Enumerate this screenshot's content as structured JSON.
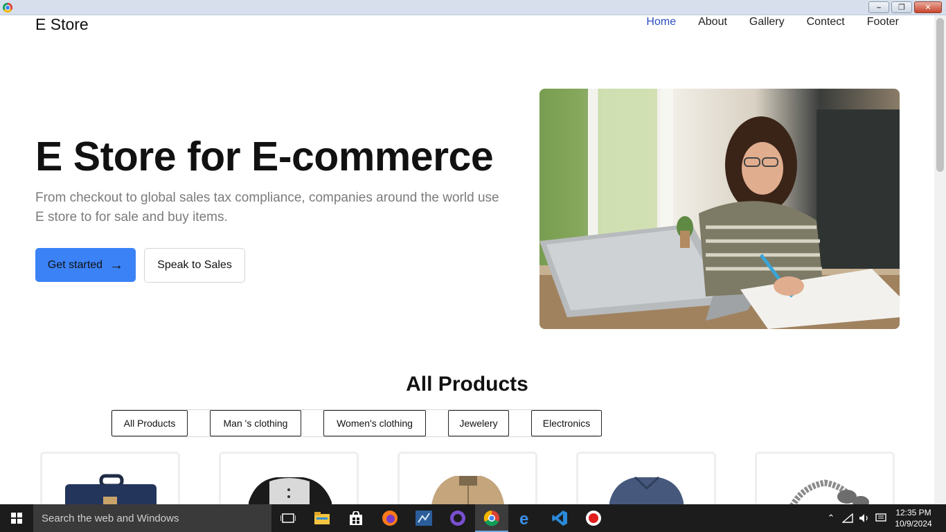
{
  "site": {
    "brand": "E Store",
    "nav": [
      "Home",
      "About",
      "Gallery",
      "Contect",
      "Footer"
    ],
    "active_nav": "Home"
  },
  "hero": {
    "title": "E Store for E-commerce",
    "subtitle": "From checkout to global sales tax compliance, companies around the world use E store to for sale and buy items.",
    "primary_button": "Get started",
    "secondary_button": "Speak to Sales",
    "image": "woman-working-on-laptop-photo"
  },
  "products": {
    "title": "All Products",
    "filters": [
      "All Products",
      "Man 's clothing",
      "Women's clothing",
      "Jewelery",
      "Electronics"
    ],
    "cards": [
      "backpack",
      "raglan-henley-shirt",
      "jacket",
      "blue-tshirt",
      "dragon-bracelet"
    ]
  },
  "taskbar": {
    "search_placeholder": "Search the web and Windows",
    "apps": [
      "task-view-icon",
      "file-explorer-icon",
      "store-icon",
      "firefox-icon",
      "sql-server-icon",
      "github-icon",
      "chrome-icon",
      "edge-icon",
      "vscode-icon",
      "recorder-icon"
    ],
    "time": "12:35 PM",
    "date": "10/9/2024"
  },
  "colors": {
    "accent": "#3b82f6",
    "nav_active": "#2b4bbf",
    "taskbar": "#1c1c1c"
  }
}
